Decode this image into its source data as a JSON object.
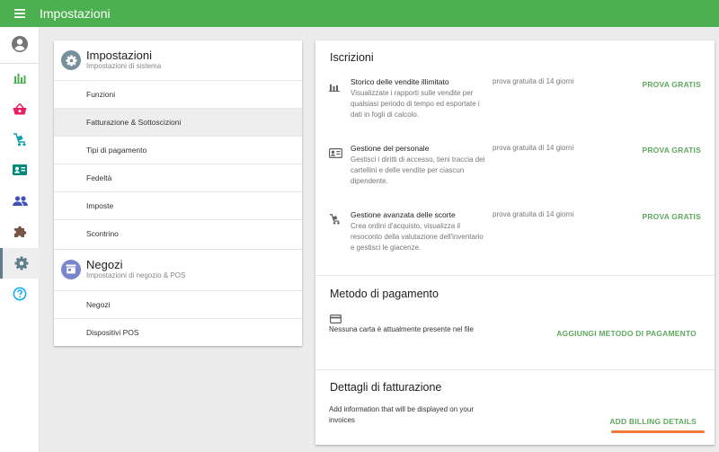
{
  "app": {
    "title": "Impostazioni"
  },
  "rail": {
    "items": [
      {
        "icon": "account-circle-icon",
        "color": "#757575"
      },
      {
        "icon": "bar-chart-icon",
        "color": "#4caf50"
      },
      {
        "icon": "basket-icon",
        "color": "#e91e63"
      },
      {
        "icon": "cart-icon",
        "color": "#0aa0b0"
      },
      {
        "icon": "customer-card-icon",
        "color": "#00897b"
      },
      {
        "icon": "people-icon",
        "color": "#3f51b5"
      },
      {
        "icon": "puzzle-icon",
        "color": "#795548"
      },
      {
        "icon": "gear-icon",
        "color": "#607d8b"
      },
      {
        "icon": "help-icon",
        "color": "#03a9f4"
      }
    ]
  },
  "settings_section": {
    "title": "Impostazioni",
    "subtitle": "Impostazioni di sistema",
    "items": [
      "Funzioni",
      "Fatturazione & Sottoscizioni",
      "Tipi di pagamento",
      "Fedeltà",
      "Imposte",
      "Scontrino"
    ]
  },
  "stores_section": {
    "title": "Negozi",
    "subtitle": "Impostazioni di negozio & POS",
    "items": [
      "Negozi",
      "Dispositivi POS"
    ]
  },
  "subscriptions": {
    "title": "Iscrizioni",
    "items": [
      {
        "name": "Storico delle vendite illimitato",
        "description": "Visualizzate i rapporti sulle vendite per qualsiasi periodo di tempo ed esportate i dati in fogli di calcolo.",
        "trial": "prova gratuita di 14 giorni",
        "action": "PROVA GRATIS"
      },
      {
        "name": "Gestione del personale",
        "description": "Gestisci i diritti di accesso, tieni traccia dei cartellini e delle vendite per ciascun dipendente.",
        "trial": "prova gratuita di 14 giorni",
        "action": "PROVA GRATIS"
      },
      {
        "name": "Gestione avanzata delle scorte",
        "description": "Crea ordini d'acquisto, visualizza il resoconto della valutazione dell'inventario e gestisci le giacenze.",
        "trial": "prova gratuita di 14 giorni",
        "action": "PROVA GRATIS"
      }
    ]
  },
  "payment_method": {
    "title": "Metodo di pagamento",
    "message": "Nessuna carta è attualmente presente nel file",
    "action": "AGGIUNGI METODO DI PAGAMENTO"
  },
  "billing_details": {
    "title": "Dettagli di fatturazione",
    "message": "Add information that will be displayed on your invoices",
    "action": "ADD BILLING DETAILS"
  },
  "colors": {
    "topbar": "#4caf50",
    "action_green": "#5fa85f",
    "highlight_orange": "#f2793a"
  }
}
